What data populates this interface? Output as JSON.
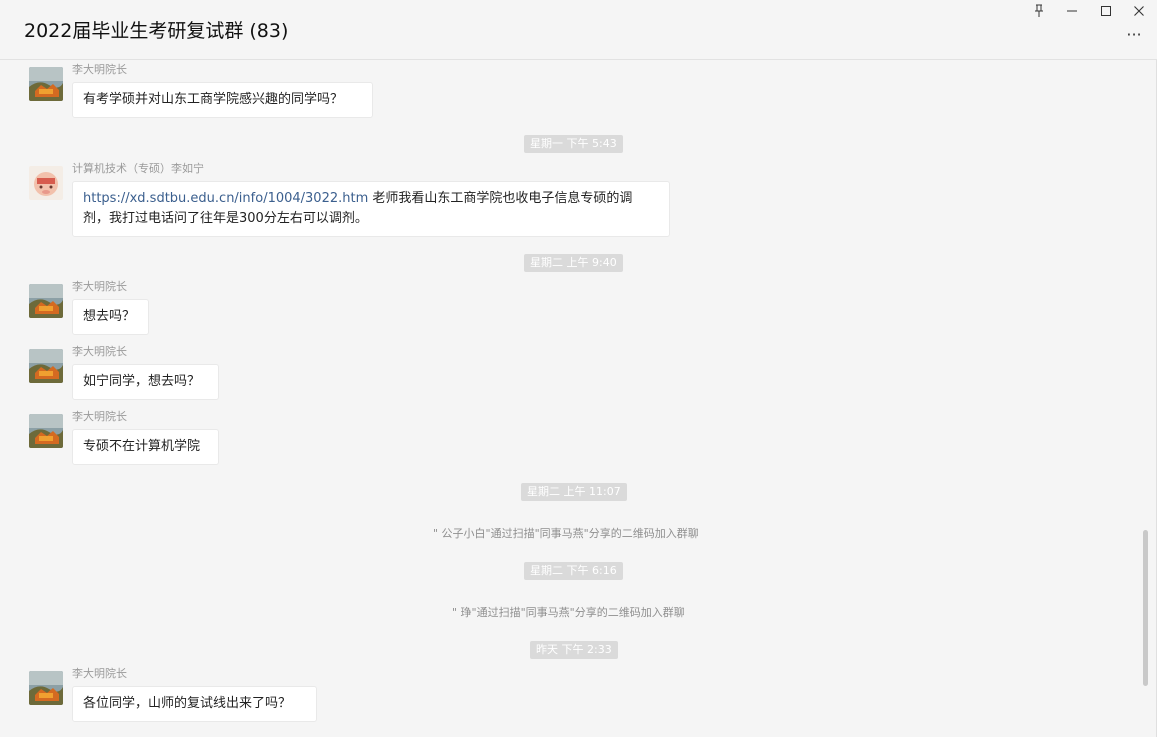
{
  "window": {
    "title": "2022届毕业生考研复试群 (83)",
    "pin_icon": "pin-icon",
    "minimize_icon": "minimize-icon",
    "maximize_icon": "maximize-icon",
    "close_icon": "close-icon",
    "more_icon": "more-icon"
  },
  "messages": [
    {
      "sender": "李大明院长",
      "text": "有考学硕并对山东工商学院感兴趣的同学吗？"
    },
    {
      "time": "星期一 下午 5:43"
    },
    {
      "sender": "计算机技术（专硕）李如宁",
      "link": "https://xd.sdtbu.edu.cn/info/1004/3022.htm",
      "text_line1": " 老师我看山东工商学院也收电子信息专硕的调",
      "text_line2": "剂，我打过电话问了往年是300分左右可以调剂。"
    },
    {
      "time": "星期二 上午 9:40"
    },
    {
      "sender": "李大明院长",
      "text": "想去吗？"
    },
    {
      "sender": "李大明院长",
      "text": "如宁同学，想去吗？"
    },
    {
      "sender": "李大明院长",
      "text": "专硕不在计算机学院"
    },
    {
      "time": "星期二 上午 11:07"
    },
    {
      "system": "\" 公子小白\"通过扫描\"同事马燕\"分享的二维码加入群聊"
    },
    {
      "time": "星期二 下午 6:16"
    },
    {
      "system": "\" 琤\"通过扫描\"同事马燕\"分享的二维码加入群聊"
    },
    {
      "time": "昨天 下午 2:33"
    },
    {
      "sender": "李大明院长",
      "text": "各位同学，山师的复试线出来了吗？"
    }
  ],
  "colors": {
    "background": "#f5f5f5",
    "bubble": "#ffffff",
    "time_badge": "#dadada",
    "link": "#3b5f8e"
  }
}
